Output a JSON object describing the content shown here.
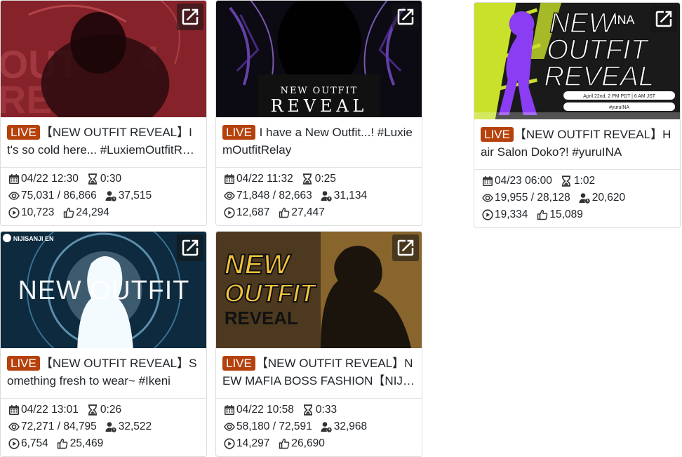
{
  "cards": [
    {
      "live_badge": "LIVE",
      "title": "【NEW OUTFIT REVEAL】It's so cold here... #LuxiemOutfitRelay",
      "date": "04/22 12:30",
      "duration": "0:30",
      "views": "75,031 / 86,866",
      "members": "37,515",
      "plays": "10,723",
      "likes": "24,294",
      "thumb_text": ""
    },
    {
      "live_badge": "LIVE",
      "title": "I have a New Outfit...! #LuxiemOutfitRelay",
      "date": "04/22 11:32",
      "duration": "0:25",
      "views": "71,848 / 82,663",
      "members": "31,134",
      "plays": "12,687",
      "likes": "27,447",
      "thumb_line1": "NEW OUTFIT",
      "thumb_line2": "REVEAL"
    },
    {
      "live_badge": "LIVE",
      "title": "【NEW OUTFIT REVEAL】Hair Salon Doko?! #yuruINA",
      "date": "04/23 06:00",
      "duration": "1:02",
      "views": "19,955 / 28,128",
      "members": "20,620",
      "plays": "19,334",
      "likes": "15,089",
      "thumb_line1": "NEW",
      "thumb_line2": "OUTFIT",
      "thumb_line3": "REVEAL",
      "thumb_corner": "INA",
      "thumb_date": "April 22nd, 2 PM PDT | 6 AM JST",
      "thumb_tag": "#yuruINA"
    },
    {
      "live_badge": "LIVE",
      "title": "【NEW OUTFIT REVEAL】Something fresh to wear~ #Ikeni",
      "date": "04/22 13:01",
      "duration": "0:26",
      "views": "72,271 / 84,795",
      "members": "32,522",
      "plays": "6,754",
      "likes": "25,469",
      "thumb_line1": "NEW OUTFIT",
      "thumb_logo": "NIJISANJI EN"
    },
    {
      "live_badge": "LIVE",
      "title": "【NEW OUTFIT REVEAL】NEW MAFIA BOSS FASHION【NIJISANJI EN】",
      "date": "04/22 10:58",
      "duration": "0:33",
      "views": "58,180 / 72,591",
      "members": "32,968",
      "plays": "14,297",
      "likes": "26,690",
      "thumb_line1": "NEW",
      "thumb_line2": "OUTFIT",
      "thumb_line3": "REVEAL"
    }
  ],
  "colors": {
    "live_badge": "#b5410c",
    "card_border": "#dcdcdc"
  },
  "icons": [
    "external-link-icon",
    "calendar-icon",
    "hourglass-icon",
    "eye-icon",
    "user-clock-icon",
    "play-circle-icon",
    "thumbs-up-icon"
  ]
}
